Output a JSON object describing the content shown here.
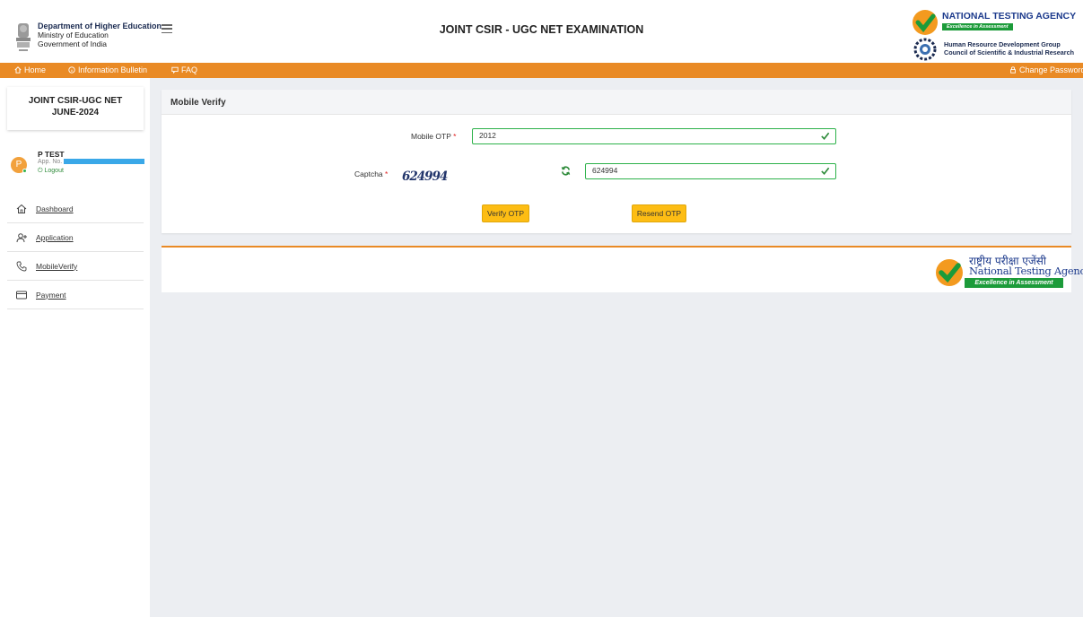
{
  "header": {
    "dept_line1": "Department of Higher Education",
    "dept_line2": "Ministry of Education",
    "dept_line3": "Government of India",
    "title": "JOINT CSIR - UGC NET EXAMINATION",
    "agency_name": "NATIONAL TESTING AGENCY",
    "agency_tagline": "Excellence in Assessment",
    "hrd_line1": "Human Resource Development Group",
    "hrd_line2": "Council of Scientific & Industrial Research"
  },
  "navbar": {
    "home": "Home",
    "info_bulletin": "Information Bulletin",
    "faq": "FAQ",
    "change_password": "Change Password"
  },
  "sidebar": {
    "exam_line1": "JOINT CSIR-UGC NET",
    "exam_line2": "JUNE-2024",
    "user": {
      "initial": "P",
      "name": "P TEST",
      "app_label": "App. No.",
      "logout": "Logout"
    },
    "items": [
      {
        "label": "Dashboard",
        "icon": "home-icon"
      },
      {
        "label": "Application",
        "icon": "add-user-icon"
      },
      {
        "label": "MobileVerify",
        "icon": "phone-icon"
      },
      {
        "label": "Payment",
        "icon": "credit-card-icon"
      }
    ]
  },
  "main": {
    "section_title": "Mobile Verify",
    "mobile_otp_label": "Mobile OTP",
    "mobile_otp_value": "2012",
    "captcha_label": "Captcha",
    "captcha_image_text": "624994",
    "captcha_value": "624994",
    "verify_button": "Verify OTP",
    "resend_button": "Resend OTP"
  },
  "footer": {
    "agency_hindi": "राष्ट्रीय परीक्षा एजेंसी",
    "agency_english": "National Testing Agency",
    "agency_tagline": "Excellence in Assessment"
  },
  "colors": {
    "accent_orange": "#e98a25",
    "button_yellow": "#fdbd14",
    "success_green": "#2db24a",
    "brand_blue": "#1c3a8c"
  }
}
